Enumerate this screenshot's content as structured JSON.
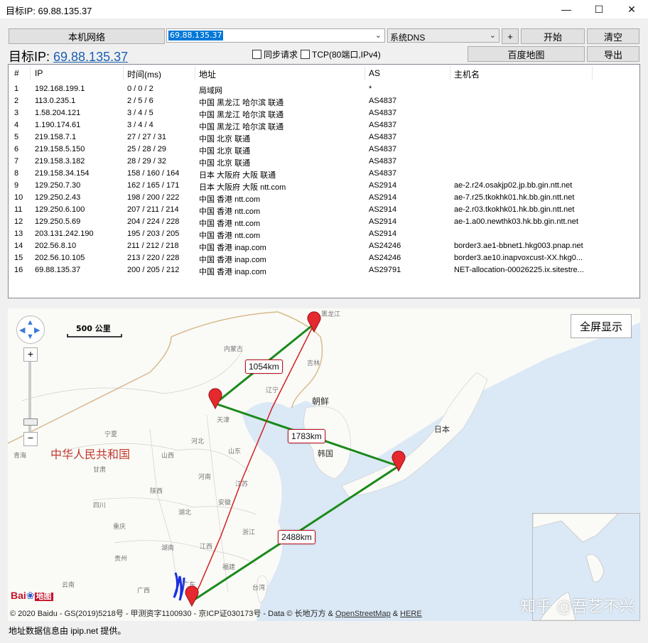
{
  "window": {
    "title": "目标IP: 69.88.135.37",
    "minimize": "—",
    "maximize": "☐",
    "close": "✕"
  },
  "toolbar": {
    "local_network_label": "本机网络",
    "ip_input_value": "69.88.135.37",
    "dns_select_value": "系统DNS",
    "add_label": "+",
    "start_label": "开始",
    "clear_label": "清空",
    "target_prefix": "目标IP: ",
    "target_ip": "69.88.135.37",
    "sync_request_label": "同步请求",
    "tcp_label": "TCP(80端口,IPv4)",
    "baidu_map_label": "百度地图",
    "export_label": "导出"
  },
  "table": {
    "headers": [
      "#",
      "IP",
      "时间(ms)",
      "地址",
      "AS",
      "主机名"
    ],
    "rows": [
      [
        "1",
        "192.168.199.1",
        "0 / 0 / 2",
        "局域网",
        "*",
        ""
      ],
      [
        "2",
        "113.0.235.1",
        "2 / 5 / 6",
        "中国 黑龙江 哈尔滨 联通",
        "AS4837",
        ""
      ],
      [
        "3",
        "1.58.204.121",
        "3 / 4 / 5",
        "中国 黑龙江 哈尔滨 联通",
        "AS4837",
        ""
      ],
      [
        "4",
        "1.190.174.61",
        "3 / 4 / 4",
        "中国 黑龙江 哈尔滨 联通",
        "AS4837",
        ""
      ],
      [
        "5",
        "219.158.7.1",
        "27 / 27 / 31",
        "中国 北京 联通",
        "AS4837",
        ""
      ],
      [
        "6",
        "219.158.5.150",
        "25 / 28 / 29",
        "中国 北京 联通",
        "AS4837",
        ""
      ],
      [
        "7",
        "219.158.3.182",
        "28 / 29 / 32",
        "中国 北京 联通",
        "AS4837",
        ""
      ],
      [
        "8",
        "219.158.34.154",
        "158 / 160 / 164",
        "日本 大阪府 大阪 联通",
        "AS4837",
        ""
      ],
      [
        "9",
        "129.250.7.30",
        "162 / 165 / 171",
        "日本 大阪府 大阪 ntt.com",
        "AS2914",
        "ae-2.r24.osakjp02.jp.bb.gin.ntt.net"
      ],
      [
        "10",
        "129.250.2.43",
        "198 / 200 / 222",
        "中国 香港 ntt.com",
        "AS2914",
        "ae-7.r25.tkokhk01.hk.bb.gin.ntt.net"
      ],
      [
        "11",
        "129.250.6.100",
        "207 / 211 / 214",
        "中国 香港 ntt.com",
        "AS2914",
        "ae-2.r03.tkokhk01.hk.bb.gin.ntt.net"
      ],
      [
        "12",
        "129.250.5.69",
        "204 / 224 / 228",
        "中国 香港 ntt.com",
        "AS2914",
        "ae-1.a00.newthk03.hk.bb.gin.ntt.net"
      ],
      [
        "13",
        "203.131.242.190",
        "195 / 203 / 205",
        "中国 香港 ntt.com",
        "AS2914",
        ""
      ],
      [
        "14",
        "202.56.8.10",
        "211 / 212 / 218",
        "中国 香港 inap.com",
        "AS24246",
        "border3.ae1-bbnet1.hkg003.pnap.net"
      ],
      [
        "15",
        "202.56.10.105",
        "213 / 220 / 228",
        "中国 香港 inap.com",
        "AS24246",
        "border3.ae10.inapvoxcust-XX.hkg0..."
      ],
      [
        "16",
        "69.88.135.37",
        "200 / 205 / 212",
        "中国 香港 inap.com",
        "AS29791",
        "NET-allocation-00026225.ix.sitestre..."
      ]
    ]
  },
  "map": {
    "scale_label": "500 公里",
    "fullscreen_label": "全屏显示",
    "distances": [
      "1054km",
      "1783km",
      "2488km"
    ],
    "region_labels": [
      "黑龙江",
      "内蒙古",
      "吉林",
      "辽宁",
      "天津",
      "朝鲜",
      "日本",
      "韩国",
      "中华人民共和国",
      "青海",
      "甘肃",
      "宁夏",
      "山西",
      "河北",
      "山东",
      "河南",
      "江苏",
      "安徽",
      "陕西",
      "四川",
      "湖北",
      "重庆",
      "浙江",
      "湖南",
      "江西",
      "贵州",
      "福建",
      "台湾",
      "云南",
      "广西",
      "广东"
    ],
    "copyright_text": "© 2020 Baidu - GS(2019)5218号 - 甲测资字1100930 - 京ICP证030173号 - Data © 长地万方 & ",
    "osm_link": "OpenStreetMap",
    "amp": " & ",
    "here_link": "HERE",
    "logo_text": "Bai",
    "logo_suffix": "地图",
    "watermark": "知乎 @吾艺不兴",
    "colors": {
      "route_green": "#1a8a1a",
      "route_red": "#d42020",
      "marker_red": "#e5292e"
    }
  },
  "status_text": "地址数据信息由 ipip.net 提供。"
}
